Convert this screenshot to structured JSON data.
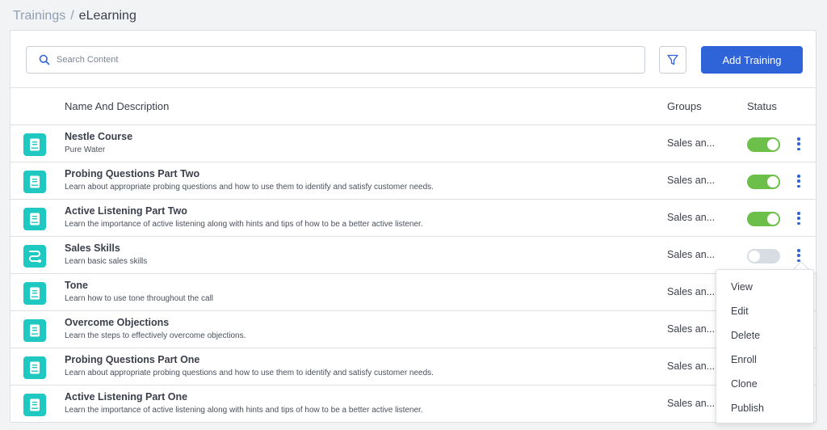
{
  "breadcrumb": {
    "parent": "Trainings",
    "separator": "/",
    "current": "eLearning"
  },
  "toolbar": {
    "search_placeholder": "Search Content",
    "add_label": "Add Training"
  },
  "table": {
    "headers": {
      "name": "Name And Description",
      "groups": "Groups",
      "status": "Status"
    },
    "rows": [
      {
        "title": "Nestle Course",
        "description": "Pure Water",
        "group": "Sales an...",
        "status": "on",
        "icon": "book-icon"
      },
      {
        "title": "Probing Questions Part Two",
        "description": "Learn about appropriate probing questions and how to use them to identify and satisfy customer needs.",
        "group": "Sales an...",
        "status": "on",
        "icon": "book-icon"
      },
      {
        "title": "Active Listening Part Two",
        "description": "Learn the importance of active listening along with hints and tips of how to be a better active listener.",
        "group": "Sales an...",
        "status": "on",
        "icon": "book-icon"
      },
      {
        "title": "Sales Skills",
        "description": "Learn basic sales skills",
        "group": "Sales an...",
        "status": "off",
        "icon": "path-icon"
      },
      {
        "title": "Tone",
        "description": "Learn how to use tone throughout the call",
        "group": "Sales an...",
        "status": "none",
        "icon": "book-icon"
      },
      {
        "title": "Overcome Objections",
        "description": "Learn the steps to effectively overcome objections.",
        "group": "Sales an...",
        "status": "none",
        "icon": "book-icon"
      },
      {
        "title": "Probing Questions Part One",
        "description": "Learn about appropriate probing questions and how to use them to identify and satisfy customer needs.",
        "group": "Sales an...",
        "status": "none",
        "icon": "book-icon"
      },
      {
        "title": "Active Listening Part One",
        "description": "Learn the importance of active listening along with hints and tips of how to be a better active listener.",
        "group": "Sales an...",
        "status": "none",
        "icon": "book-icon"
      }
    ]
  },
  "context_menu": {
    "items": [
      "View",
      "Edit",
      "Delete",
      "Enroll",
      "Clone",
      "Publish"
    ]
  },
  "colors": {
    "accent": "#2f63d8",
    "toggle_on": "#6cc04a",
    "toggle_off": "#d8dde4",
    "icon_bg": "#1fc9c1"
  }
}
